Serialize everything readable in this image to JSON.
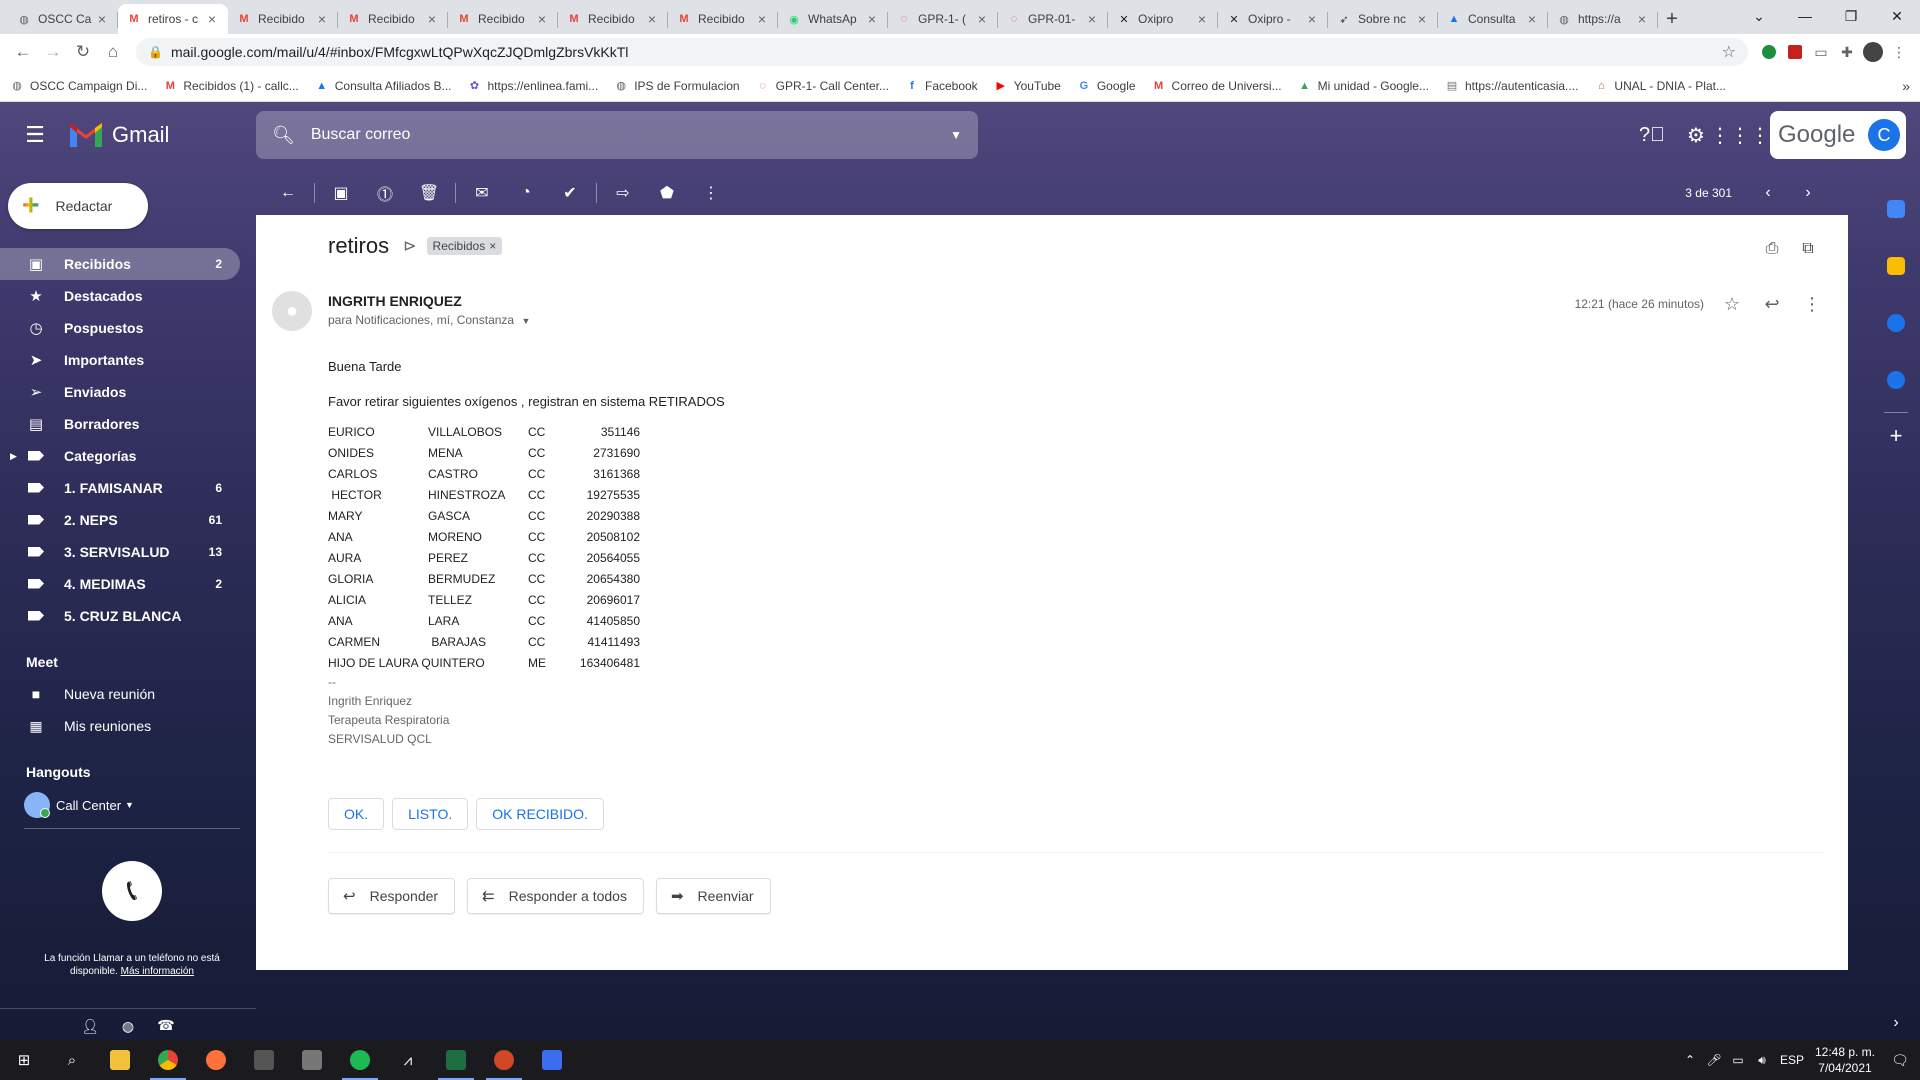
{
  "browser": {
    "tabs": [
      {
        "favicon": "globe-icon",
        "label": "OSCC Ca",
        "active": false
      },
      {
        "favicon": "gmail-icon",
        "label": "retiros - c",
        "active": true
      },
      {
        "favicon": "gmail-icon",
        "label": "Recibido",
        "active": false
      },
      {
        "favicon": "gmail-icon",
        "label": "Recibido",
        "active": false
      },
      {
        "favicon": "gmail-icon",
        "label": "Recibido",
        "active": false
      },
      {
        "favicon": "gmail-icon",
        "label": "Recibido",
        "active": false
      },
      {
        "favicon": "gmail-icon",
        "label": "Recibido",
        "active": false
      },
      {
        "favicon": "whatsapp-icon",
        "label": "WhatsAp",
        "active": false
      },
      {
        "favicon": "gpr-icon",
        "label": "GPR-1- (",
        "active": false
      },
      {
        "favicon": "gpr-icon",
        "label": "GPR-01-",
        "active": false
      },
      {
        "favicon": "x-app-icon",
        "label": "Oxipro",
        "active": false
      },
      {
        "favicon": "x-app-icon",
        "label": "Oxipro -",
        "active": false
      },
      {
        "favicon": "pointer-icon",
        "label": "Sobre nc",
        "active": false
      },
      {
        "favicon": "drive-triangle-icon",
        "label": "Consulta",
        "active": false
      },
      {
        "favicon": "globe-icon",
        "label": "https://a",
        "active": false
      }
    ],
    "new_tab": "+",
    "url": "mail.google.com/mail/u/4/#inbox/FMfcgxwLtQPwXqcZJQDmlgZbrsVkKkTl",
    "bookmarks": [
      {
        "icon": "globe-icon",
        "label": "OSCC Campaign Di..."
      },
      {
        "icon": "gmail-icon",
        "label": "Recibidos (1) - callc..."
      },
      {
        "icon": "drive-triangle-icon",
        "label": "Consulta Afiliados B..."
      },
      {
        "icon": "leaf-icon",
        "label": "https://enlinea.fami..."
      },
      {
        "icon": "globe-icon",
        "label": "IPS de Formulacion"
      },
      {
        "icon": "gpr-icon",
        "label": "GPR-1- Call Center..."
      },
      {
        "icon": "facebook-icon",
        "label": "Facebook"
      },
      {
        "icon": "youtube-icon",
        "label": "YouTube"
      },
      {
        "icon": "google-icon",
        "label": "Google"
      },
      {
        "icon": "gmail-icon",
        "label": "Correo de Universi..."
      },
      {
        "icon": "drive-icon",
        "label": "Mi unidad - Google..."
      },
      {
        "icon": "lock-page-icon",
        "label": "https://autenticasia...."
      },
      {
        "icon": "unal-icon",
        "label": "UNAL - DNIA - Plat..."
      }
    ]
  },
  "gmail": {
    "product_name": "Gmail",
    "search_placeholder": "Buscar correo",
    "google_label": "Google",
    "account_initial": "C",
    "compose_label": "Redactar",
    "nav": [
      {
        "icon": "inbox-icon",
        "label": "Recibidos",
        "count": "2",
        "active": true
      },
      {
        "icon": "star-icon",
        "label": "Destacados",
        "count": "",
        "active": false
      },
      {
        "icon": "clock-icon",
        "label": "Pospuestos",
        "count": "",
        "active": false
      },
      {
        "icon": "important-icon",
        "label": "Importantes",
        "count": "",
        "active": false
      },
      {
        "icon": "send-icon",
        "label": "Enviados",
        "count": "",
        "active": false
      },
      {
        "icon": "draft-icon",
        "label": "Borradores",
        "count": "",
        "active": false
      },
      {
        "icon": "label-icon",
        "label": "Categorías",
        "count": "",
        "active": false,
        "expandable": true
      },
      {
        "icon": "label-icon",
        "label": "1. FAMISANAR",
        "count": "6",
        "active": false
      },
      {
        "icon": "label-icon",
        "label": "2. NEPS",
        "count": "61",
        "active": false
      },
      {
        "icon": "label-icon",
        "label": "3. SERVISALUD",
        "count": "13",
        "active": false
      },
      {
        "icon": "label-icon",
        "label": "4. MEDIMAS",
        "count": "2",
        "active": false
      },
      {
        "icon": "label-icon",
        "label": "5. CRUZ BLANCA",
        "count": "",
        "active": false
      }
    ],
    "meet": {
      "title": "Meet",
      "new_meeting": "Nueva reunión",
      "my_meetings": "Mis reuniones"
    },
    "hangouts": {
      "title": "Hangouts",
      "user": "Call Center",
      "phone_msg": "La función Llamar a un teléfono no está disponible.",
      "more_info": "Más información"
    },
    "pager": {
      "text": "3 de 301"
    },
    "message": {
      "subject": "retiros",
      "label_tag": "Recibidos",
      "sender": "INGRITH ENRIQUEZ",
      "recipients": "para Notificaciones, mí, Constanza",
      "time": "12:21 (hace 26 minutos)",
      "greeting": "Buena Tarde",
      "intro": "Favor retirar siguientes oxígenos , registran en sistema RETIRADOS",
      "rows": [
        {
          "first": "EURICO",
          "last": "VILLALOBOS",
          "doc": "CC",
          "num": "351146"
        },
        {
          "first": "ONIDES",
          "last": "MENA",
          "doc": "CC",
          "num": "2731690"
        },
        {
          "first": "CARLOS",
          "last": "CASTRO",
          "doc": "CC",
          "num": "3161368"
        },
        {
          "first": " HECTOR",
          "last": "HINESTROZA",
          "doc": "CC",
          "num": "19275535"
        },
        {
          "first": "MARY",
          "last": "GASCA",
          "doc": "CC",
          "num": "20290388"
        },
        {
          "first": "ANA",
          "last": "MORENO",
          "doc": "CC",
          "num": "20508102"
        },
        {
          "first": "AURA",
          "last": "PEREZ",
          "doc": "CC",
          "num": "20564055"
        },
        {
          "first": "GLORIA",
          "last": "BERMUDEZ",
          "doc": "CC",
          "num": "20654380"
        },
        {
          "first": "ALICIA",
          "last": "TELLEZ",
          "doc": "CC",
          "num": "20696017"
        },
        {
          "first": "ANA",
          "last": "LARA",
          "doc": "CC",
          "num": "41405850"
        },
        {
          "first": "CARMEN",
          "last": " BARAJAS",
          "doc": "CC",
          "num": "41411493"
        },
        {
          "first": "HIJO DE LAURA QUINTERO",
          "last": "",
          "doc": "ME",
          "num": "163406481"
        }
      ],
      "sig_sep": "--",
      "sig_name": "Ingrith Enriquez",
      "sig_role": "Terapeuta Respiratoria",
      "sig_org": "SERVISALUD QCL",
      "smart_replies": [
        "OK.",
        "LISTO.",
        "OK RECIBIDO."
      ],
      "reply_label": "Responder",
      "reply_all_label": "Responder a todos",
      "forward_label": "Reenviar"
    }
  },
  "taskbar": {
    "lang": "ESP",
    "time": "12:48 p. m.",
    "date": "7/04/2021"
  },
  "colors": {
    "gmail_red": "#ea4335",
    "accent_blue": "#1a73e8",
    "wallpaper": "#3f3a6e"
  }
}
